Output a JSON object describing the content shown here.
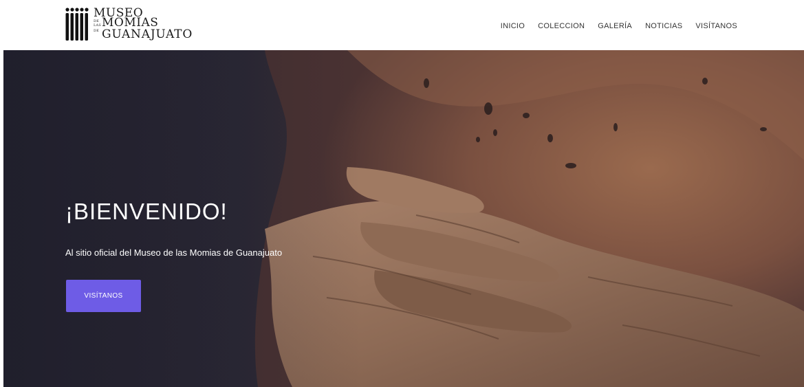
{
  "logo": {
    "line1": "MUSEO",
    "line2": "MOMIAS",
    "line3": "GUANAJUATO",
    "small1": "DE",
    "small2": "LAS",
    "small3": "DE"
  },
  "nav": {
    "items": [
      {
        "label": "INICIO"
      },
      {
        "label": "COLECCION"
      },
      {
        "label": "GALERÍA"
      },
      {
        "label": "NOTICIAS"
      },
      {
        "label": "VISÍTANOS"
      }
    ]
  },
  "hero": {
    "title": "¡BIENVENIDO!",
    "subtitle": "Al sitio oficial del Museo de las Momias de Guanajuato",
    "button_label": "VISÍTANOS"
  },
  "colors": {
    "accent": "#6e5ce6",
    "hero_dark": "#2a2838",
    "header_bg": "#ffffff"
  }
}
